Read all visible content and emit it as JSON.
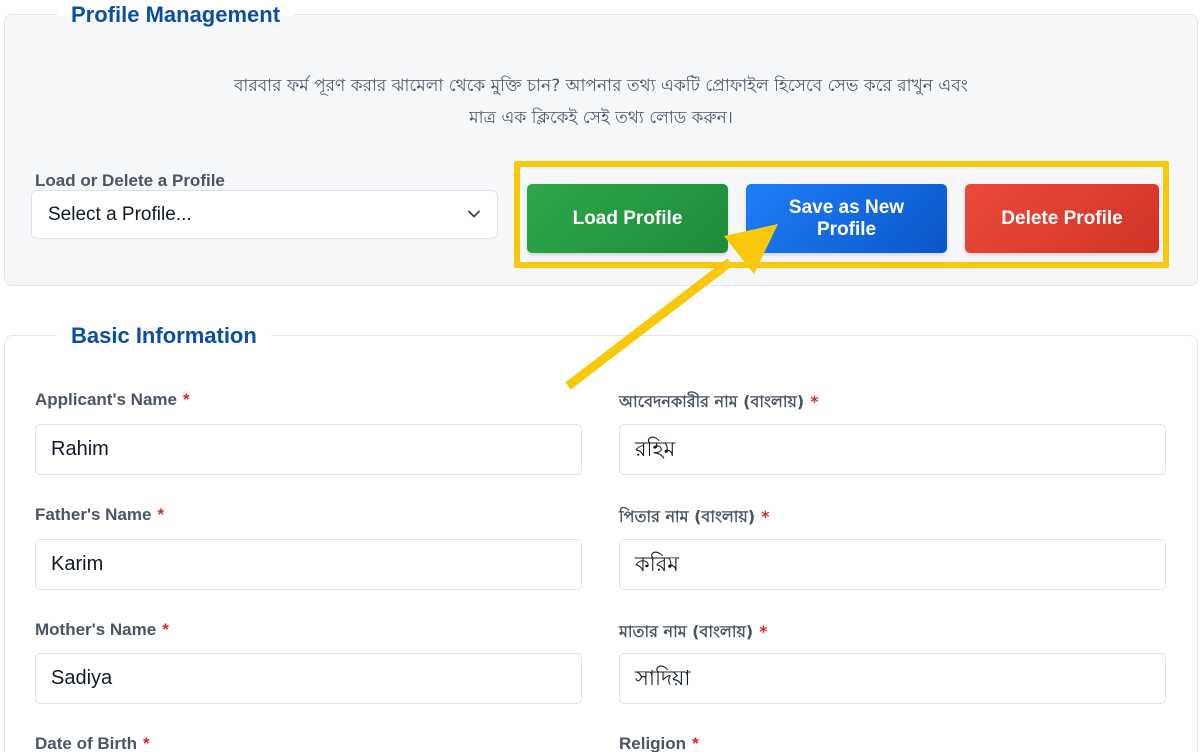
{
  "profile_management": {
    "title": "Profile Management",
    "intro_line1": "বারবার ফর্ম পূরণ করার ঝামেলা থেকে মুক্তি চান? আপনার তথ্য একটি প্রোফাইল হিসেবে সেভ করে রাখুন এবং",
    "intro_line2": "মাত্র এক ক্লিকেই সেই তথ্য লোড করুন।",
    "load_delete_label": "Load or Delete a Profile",
    "select_value": "Select a Profile...",
    "buttons": {
      "load": "Load Profile",
      "save": "Save as New Profile",
      "delete": "Delete Profile"
    },
    "colors": {
      "load": "#28a745",
      "save": "#0d6efd",
      "delete": "#dc3545",
      "highlight": "#f7c90a"
    }
  },
  "basic_information": {
    "title": "Basic Information",
    "required_mark": "*",
    "fields": {
      "applicant_name": {
        "label": "Applicant's Name",
        "value": "Rahim"
      },
      "applicant_name_bn": {
        "label": "আবেদনকারীর নাম (বাংলায়)",
        "value": "রহিম"
      },
      "father_name": {
        "label": "Father's Name",
        "value": "Karim"
      },
      "father_name_bn": {
        "label": "পিতার নাম (বাংলায়)",
        "value": "করিম"
      },
      "mother_name": {
        "label": "Mother's Name",
        "value": "Sadiya"
      },
      "mother_name_bn": {
        "label": "মাতার নাম (বাংলায়)",
        "value": "সাদিয়া"
      },
      "date_of_birth": {
        "label": "Date of Birth"
      },
      "religion": {
        "label": "Religion"
      }
    }
  },
  "icons": {
    "select": "chevron-down-icon",
    "annotation": "arrow-pointer-icon"
  }
}
